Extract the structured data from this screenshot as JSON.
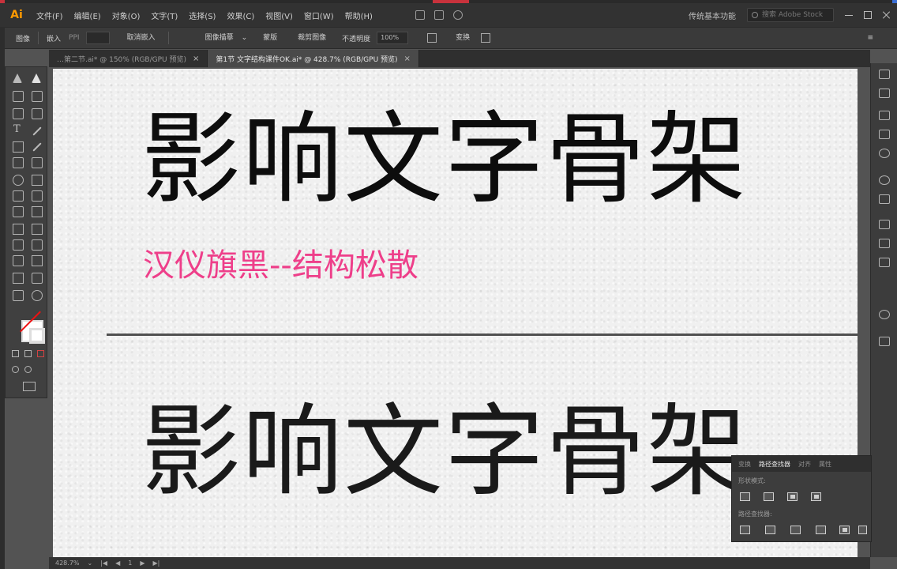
{
  "app": {
    "logo": "Ai"
  },
  "menu": {
    "items": [
      "文件(F)",
      "编辑(E)",
      "对象(O)",
      "文字(T)",
      "选择(S)",
      "效果(C)",
      "视图(V)",
      "窗口(W)",
      "帮助(H)"
    ],
    "workspace": "传统基本功能",
    "search_placeholder": "搜索 Adobe Stock"
  },
  "control": {
    "type_label": "图像",
    "embedded": "嵌入",
    "ppi_label": "PPI",
    "embed_btn": "取消嵌入",
    "trace_btn": "图像描摹",
    "mask_btn": "蒙版",
    "crop_btn": "裁剪图像",
    "opacity_label": "不透明度",
    "opacity_value": "100%",
    "transform_btn": "变换"
  },
  "tabs": [
    {
      "label": "…第二节.ai* @ 150% (RGB/GPU 预览)",
      "active": false
    },
    {
      "label": "第1节 文字结构课件OK.ai* @ 428.7% (RGB/GPU 预览)",
      "active": true
    }
  ],
  "canvas": {
    "title": "影响文字骨架",
    "subtitle": "汉仪旗黑--结构松散",
    "title_2": "影响文字骨架",
    "subtitle_color": "#ee3f8a"
  },
  "pathfinder": {
    "tabs": [
      "变换",
      "路径查找器",
      "对齐",
      "属性"
    ],
    "shape_modes_label": "形状模式:",
    "pathfinders_label": "路径查找器:"
  },
  "status": {
    "zoom": "428.7%",
    "page": "1"
  },
  "colors": {
    "accent": "#ff9a00",
    "canvas_bg": "#f0f0f0",
    "chrome": "#323232"
  }
}
